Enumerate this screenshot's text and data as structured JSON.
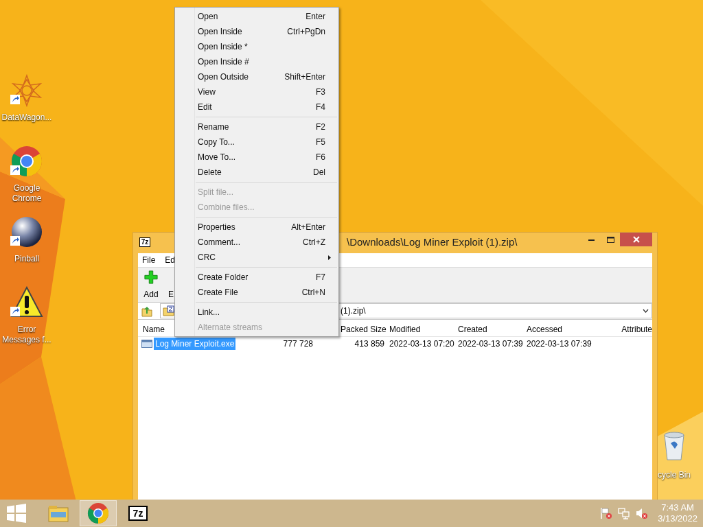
{
  "desktop_icons": [
    {
      "kind": "star",
      "label": "DataWagon..."
    },
    {
      "kind": "chrome",
      "label": "Google Chrome"
    },
    {
      "kind": "ball",
      "label": "Pinball"
    },
    {
      "kind": "warning",
      "label": "Error Messages f..."
    }
  ],
  "recycle_bin": {
    "label": "cycle Bin"
  },
  "window": {
    "app_icon_text": "7z",
    "title": "\\Downloads\\Log Miner Exploit (1).zip\\",
    "menu": [
      "File",
      "Ed"
    ],
    "toolbar": [
      "Add",
      "E"
    ],
    "address": "(1).zip\\",
    "columns": [
      "Name",
      "",
      "Packed Size",
      "Modified",
      "Created",
      "Accessed",
      "Attribute"
    ],
    "rows": [
      {
        "selected": true,
        "cells": [
          "Log Miner Exploit.exe",
          "777 728",
          "413 859",
          "2022-03-13 07:20",
          "2022-03-13 07:39",
          "2022-03-13 07:39"
        ]
      }
    ]
  },
  "context_menu": {
    "items": [
      {
        "kind": "item",
        "label": "Open",
        "shortcut": "Enter",
        "disabled": false,
        "submenu": false
      },
      {
        "kind": "item",
        "label": "Open Inside",
        "shortcut": "Ctrl+PgDn",
        "disabled": false,
        "submenu": false
      },
      {
        "kind": "item",
        "label": "Open Inside *",
        "disabled": false,
        "submenu": false
      },
      {
        "kind": "item",
        "label": "Open Inside #",
        "disabled": false,
        "submenu": false
      },
      {
        "kind": "item",
        "label": "Open Outside",
        "shortcut": "Shift+Enter",
        "disabled": false,
        "submenu": false
      },
      {
        "kind": "item",
        "label": "View",
        "shortcut": "F3",
        "disabled": false,
        "submenu": false
      },
      {
        "kind": "item",
        "label": "Edit",
        "shortcut": "F4",
        "disabled": false,
        "submenu": false
      },
      {
        "kind": "separator"
      },
      {
        "kind": "item",
        "label": "Rename",
        "shortcut": "F2",
        "disabled": false,
        "submenu": false
      },
      {
        "kind": "item",
        "label": "Copy To...",
        "shortcut": "F5",
        "disabled": false,
        "submenu": false
      },
      {
        "kind": "item",
        "label": "Move To...",
        "shortcut": "F6",
        "disabled": false,
        "submenu": false
      },
      {
        "kind": "item",
        "label": "Delete",
        "shortcut": "Del",
        "disabled": false,
        "submenu": false
      },
      {
        "kind": "separator"
      },
      {
        "kind": "item",
        "label": "Split file...",
        "disabled": true,
        "submenu": false
      },
      {
        "kind": "item",
        "label": "Combine files...",
        "disabled": true,
        "submenu": false
      },
      {
        "kind": "separator"
      },
      {
        "kind": "item",
        "label": "Properties",
        "shortcut": "Alt+Enter",
        "disabled": false,
        "submenu": false
      },
      {
        "kind": "item",
        "label": "Comment...",
        "shortcut": "Ctrl+Z",
        "disabled": false,
        "submenu": false
      },
      {
        "kind": "item",
        "label": "CRC",
        "disabled": false,
        "submenu": true
      },
      {
        "kind": "separator"
      },
      {
        "kind": "item",
        "label": "Create Folder",
        "shortcut": "F7",
        "disabled": false,
        "submenu": false
      },
      {
        "kind": "item",
        "label": "Create File",
        "shortcut": "Ctrl+N",
        "disabled": false,
        "submenu": false
      },
      {
        "kind": "separator"
      },
      {
        "kind": "item",
        "label": "Link...",
        "disabled": false,
        "submenu": false
      },
      {
        "kind": "item",
        "label": "Alternate streams",
        "disabled": true,
        "submenu": false
      }
    ]
  },
  "taskbar": {
    "buttons": [
      {
        "kind": "explorer",
        "selected": false
      },
      {
        "kind": "chrome",
        "selected": true
      },
      {
        "kind": "sevenzip",
        "selected": false,
        "icon_text": "7z"
      }
    ],
    "time": "7:43 AM",
    "date": "3/13/2022"
  }
}
